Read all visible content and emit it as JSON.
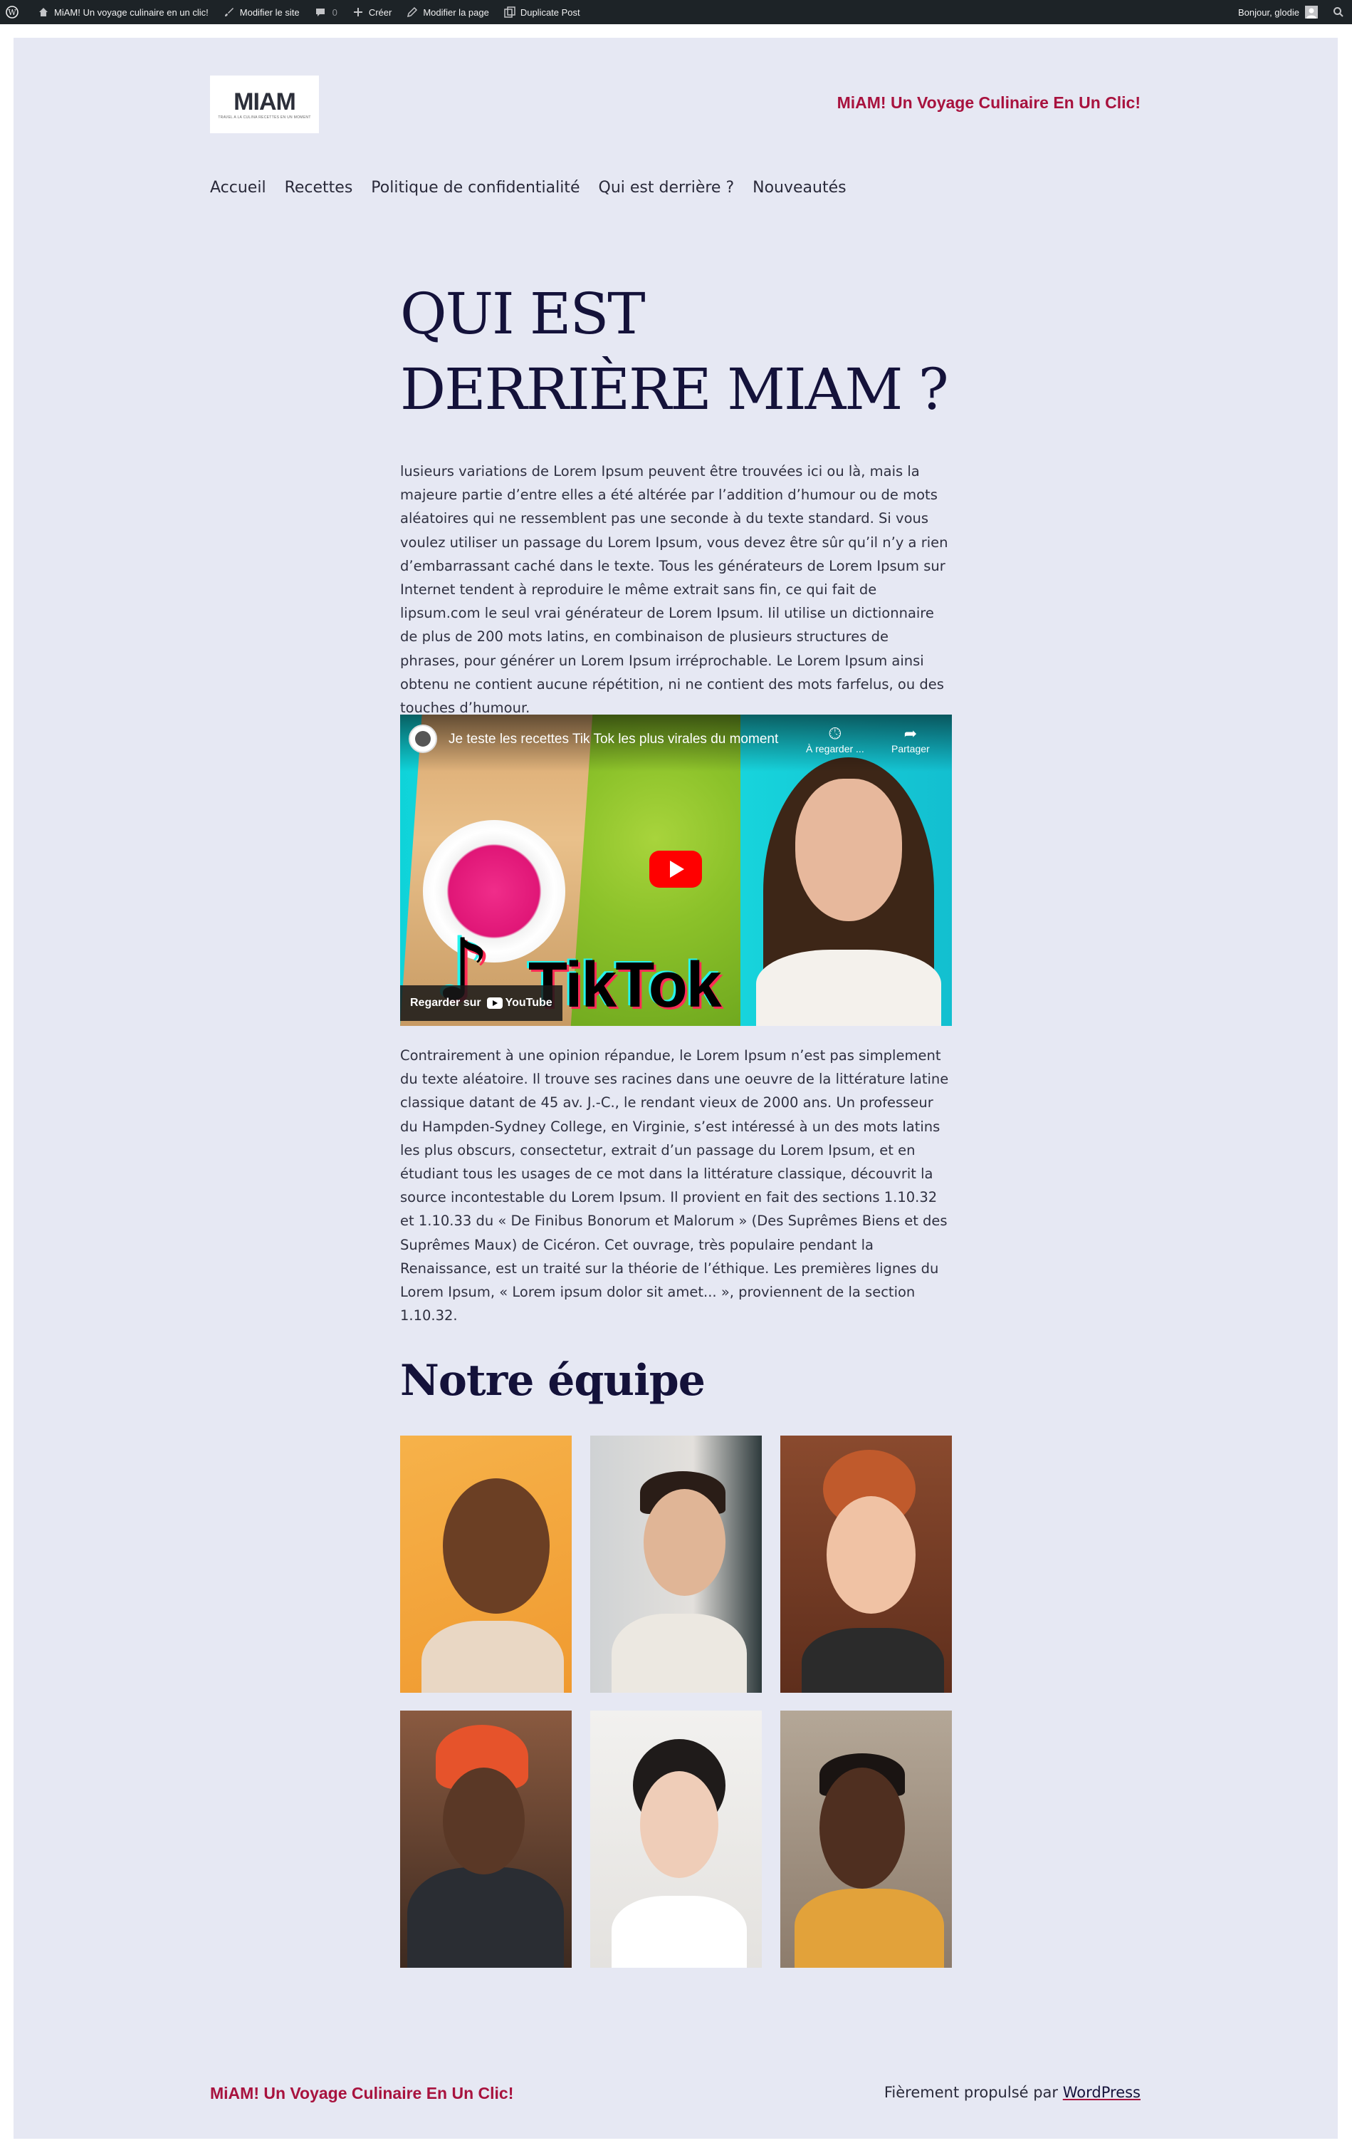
{
  "admin_bar": {
    "site_name": "MiAM! Un voyage culinaire en un clic!",
    "edit_site": "Modifier le site",
    "comments_count": "0",
    "new": "Créer",
    "edit_page": "Modifier la page",
    "duplicate": "Duplicate Post",
    "greeting": "Bonjour, glodie",
    "icons": [
      "wordpress-icon",
      "home-icon",
      "paintbrush-icon",
      "comment-icon",
      "plus-icon",
      "pencil-icon",
      "duplicate-icon",
      "avatar-icon",
      "search-icon"
    ]
  },
  "header": {
    "logo_text": "MIAM",
    "logo_tagline": "TRAVEL A LA CULINA RECETTES EN UN MOMENT",
    "site_title": "MiAM! Un Voyage Culinaire En Un Clic!",
    "nav": [
      "Accueil",
      "Recettes",
      "Politique de confidentialité",
      "Qui est derrière ?",
      "Nouveautés"
    ]
  },
  "page": {
    "title": "QUI EST DERRIÈRE MIAM ?",
    "paragraph1": "lusieurs variations de Lorem Ipsum peuvent être trouvées ici ou là, mais la majeure partie d’entre elles a été altérée par l’addition d’humour ou de mots aléatoires qui ne ressemblent pas une seconde à du texte standard. Si vous voulez utiliser un passage du Lorem Ipsum, vous devez être sûr qu’il n’y a rien d’embarrassant caché dans le texte. Tous les générateurs de Lorem Ipsum sur Internet tendent à reproduire le même extrait sans fin, ce qui fait de lipsum.com le seul vrai générateur de Lorem Ipsum. Iil utilise un dictionnaire de plus de 200 mots latins, en combinaison de plusieurs structures de phrases, pour générer un Lorem Ipsum irréprochable. Le Lorem Ipsum ainsi obtenu ne contient aucune répétition, ni ne contient des mots farfelus, ou des touches d’humour.",
    "video": {
      "title": "Je teste les recettes Tik Tok les plus virales du moment",
      "watch_later": "À regarder ...",
      "share": "Partager",
      "watch_on": "Regarder sur",
      "youtube": "YouTube",
      "thumbnail_text": "TikTok"
    },
    "paragraph2": "Contrairement à une opinion répandue, le Lorem Ipsum n’est pas simplement du texte aléatoire. Il trouve ses racines dans une oeuvre de la littérature latine classique datant de 45 av. J.-C., le rendant vieux de 2000 ans. Un professeur du Hampden-Sydney College, en Virginie, s’est intéressé à un des mots latins les plus obscurs, consectetur, extrait d’un passage du Lorem Ipsum, et en étudiant tous les usages de ce mot dans la littérature classique, découvrit la source incontestable du Lorem Ipsum. Il provient en fait des sections 1.10.32 et 1.10.33 du « De Finibus Bonorum et Malorum » (Des Suprêmes Biens et des Suprêmes Maux) de Cicéron. Cet ouvrage, très populaire pendant la Renaissance, est un traité sur la théorie de l’éthique. Les premières lignes du Lorem Ipsum, « Lorem ipsum dolor sit amet... », proviennent de la section 1.10.32.",
    "team_heading": "Notre équipe",
    "team_photos": [
      {
        "name": "team-photo-1",
        "bg": "#f3a43b"
      },
      {
        "name": "team-photo-2",
        "bg": "#d7d3cf"
      },
      {
        "name": "team-photo-3",
        "bg": "#7a3f28"
      },
      {
        "name": "team-photo-4",
        "bg": "#5a3a2a"
      },
      {
        "name": "team-photo-5",
        "bg": "#eceae8"
      },
      {
        "name": "team-photo-6",
        "bg": "#a59484"
      }
    ]
  },
  "footer": {
    "site_title": "MiAM! Un Voyage Culinaire En Un Clic!",
    "credit_prefix": "Fièrement propulsé par",
    "credit_link": "WordPress"
  },
  "colors": {
    "accent": "#a8123e",
    "background": "#e6e8f3",
    "heading": "#14123a",
    "admin_bar": "#1d2327"
  }
}
